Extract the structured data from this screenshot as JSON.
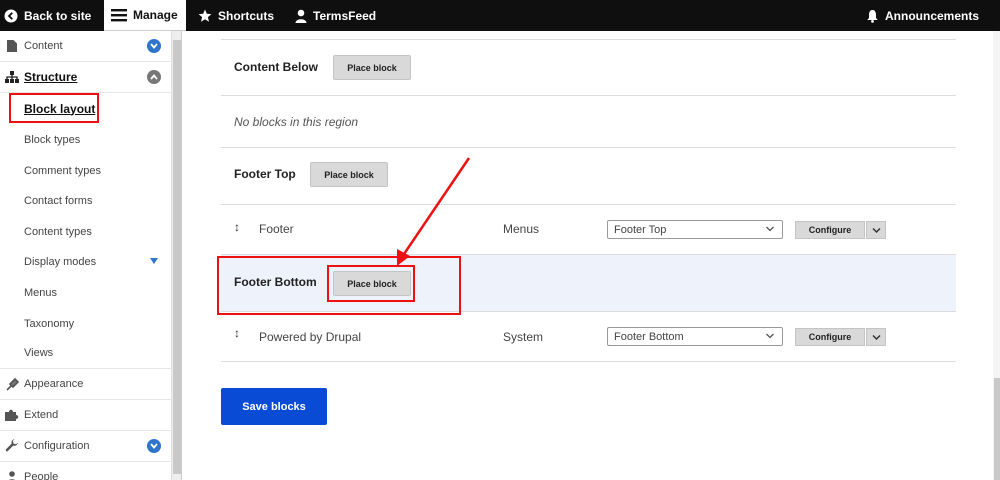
{
  "toolbar": {
    "back_label": "Back to site",
    "manage_label": "Manage",
    "shortcuts_label": "Shortcuts",
    "user_label": "TermsFeed",
    "announcements_label": "Announcements"
  },
  "sidebar": {
    "items": [
      {
        "label": "Content",
        "icon": "file-icon"
      },
      {
        "label": "Structure",
        "icon": "sitemap-icon"
      },
      {
        "label": "Block layout"
      },
      {
        "label": "Block types"
      },
      {
        "label": "Comment types"
      },
      {
        "label": "Contact forms"
      },
      {
        "label": "Content types"
      },
      {
        "label": "Display modes"
      },
      {
        "label": "Menus"
      },
      {
        "label": "Taxonomy"
      },
      {
        "label": "Views"
      },
      {
        "label": "Appearance",
        "icon": "brush-icon"
      },
      {
        "label": "Extend",
        "icon": "puzzle-icon"
      },
      {
        "label": "Configuration",
        "icon": "wrench-icon"
      },
      {
        "label": "People",
        "icon": "person-icon"
      }
    ]
  },
  "regions": {
    "content_below": {
      "title": "Content Below",
      "place_label": "Place block",
      "empty_text": "No blocks in this region"
    },
    "footer_top": {
      "title": "Footer Top",
      "place_label": "Place block"
    },
    "footer_bottom": {
      "title": "Footer Bottom",
      "place_label": "Place block"
    }
  },
  "blocks": [
    {
      "name": "Footer",
      "category": "Menus",
      "region": "Footer Top",
      "configure_label": "Configure"
    },
    {
      "name": "Powered by Drupal",
      "category": "System",
      "region": "Footer Bottom",
      "configure_label": "Configure"
    }
  ],
  "save_label": "Save blocks",
  "colors": {
    "accent": "#0a4bd6",
    "toggle": "#2f76c9",
    "highlight": "#e11111",
    "toolbar": "#0f0f0f"
  }
}
